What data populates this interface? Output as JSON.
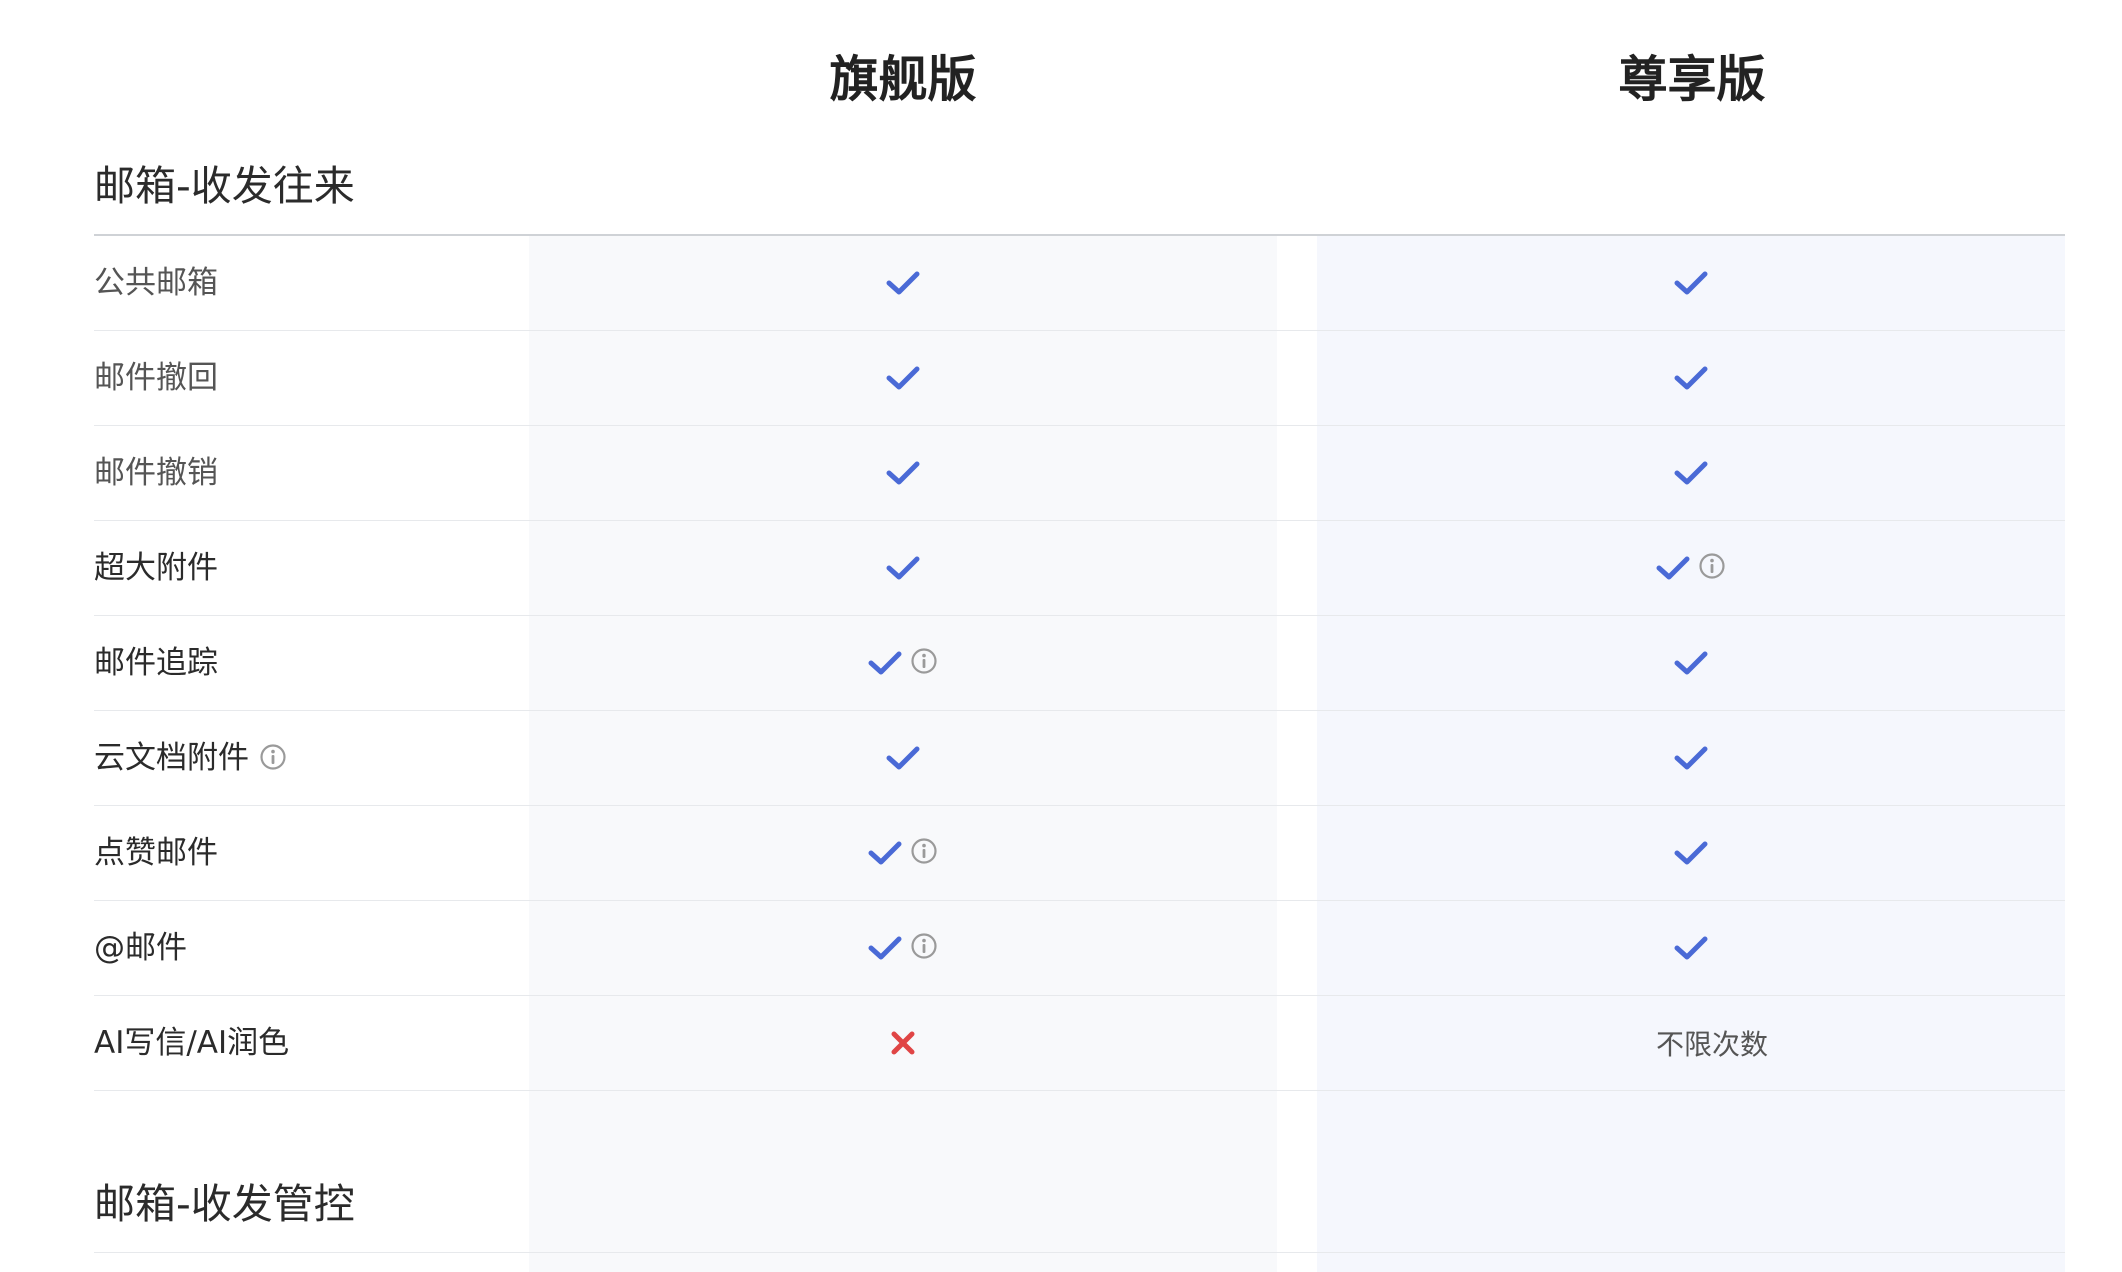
{
  "plans": [
    "旗舰版",
    "尊享版"
  ],
  "sections": [
    {
      "title": "邮箱-收发往来",
      "rows": [
        {
          "label": "公共邮箱",
          "muted": true,
          "label_info": false,
          "values": [
            {
              "type": "check",
              "info": false
            },
            {
              "type": "check",
              "info": false
            }
          ]
        },
        {
          "label": "邮件撤回",
          "muted": true,
          "label_info": false,
          "values": [
            {
              "type": "check",
              "info": false
            },
            {
              "type": "check",
              "info": false
            }
          ]
        },
        {
          "label": "邮件撤销",
          "muted": true,
          "label_info": false,
          "values": [
            {
              "type": "check",
              "info": false
            },
            {
              "type": "check",
              "info": false
            }
          ]
        },
        {
          "label": "超大附件",
          "muted": false,
          "label_info": false,
          "values": [
            {
              "type": "check",
              "info": false
            },
            {
              "type": "check",
              "info": true
            }
          ]
        },
        {
          "label": "邮件追踪",
          "muted": false,
          "label_info": false,
          "values": [
            {
              "type": "check",
              "info": true
            },
            {
              "type": "check",
              "info": false
            }
          ]
        },
        {
          "label": "云文档附件",
          "muted": false,
          "label_info": true,
          "values": [
            {
              "type": "check",
              "info": false
            },
            {
              "type": "check",
              "info": false
            }
          ]
        },
        {
          "label": "点赞邮件",
          "muted": false,
          "label_info": false,
          "values": [
            {
              "type": "check",
              "info": true
            },
            {
              "type": "check",
              "info": false
            }
          ]
        },
        {
          "label": "@邮件",
          "muted": false,
          "label_info": false,
          "values": [
            {
              "type": "check",
              "info": true
            },
            {
              "type": "check",
              "info": false
            }
          ]
        },
        {
          "label": "AI写信/AI润色",
          "muted": false,
          "label_info": false,
          "values": [
            {
              "type": "cross",
              "info": false
            },
            {
              "type": "text",
              "text": "不限次数",
              "info": false
            }
          ]
        }
      ]
    },
    {
      "title": "邮箱-收发管控",
      "rows": []
    }
  ],
  "colors": {
    "check": "#4a6ad6",
    "cross": "#e04545",
    "info": "#9a9a9a"
  }
}
